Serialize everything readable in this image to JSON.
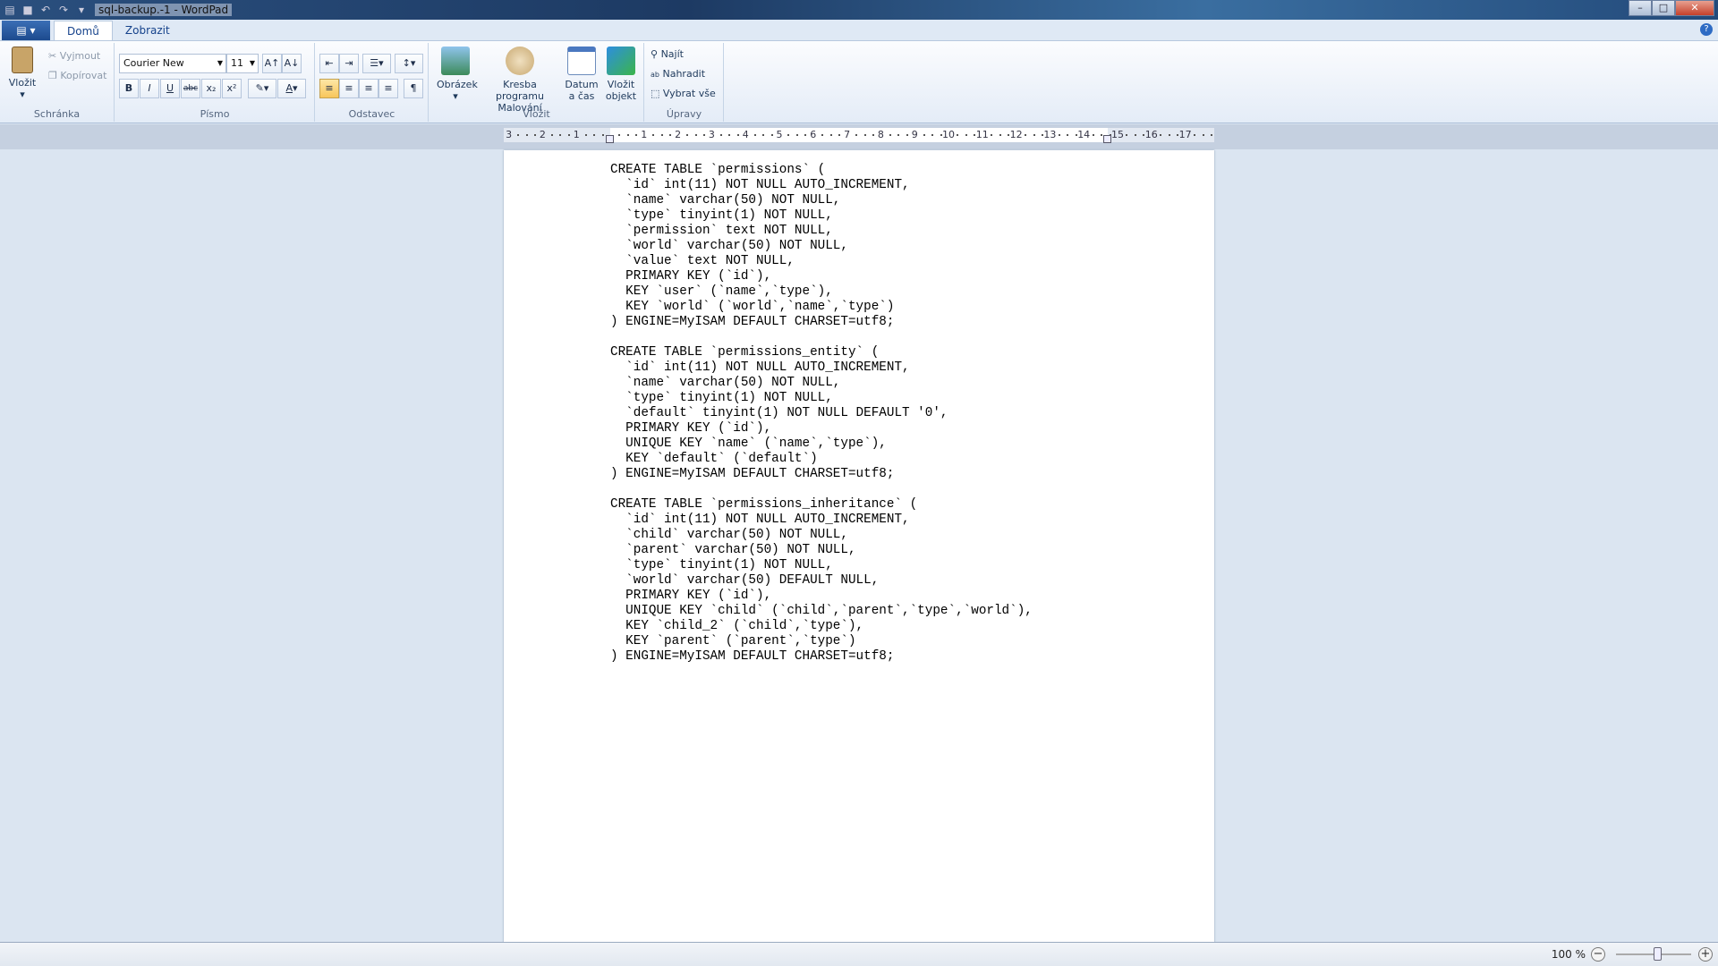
{
  "window": {
    "title": "sql-backup.-1 - WordPad"
  },
  "tabs": [
    {
      "label": "Domů",
      "active": true
    },
    {
      "label": "Zobrazit",
      "active": false
    }
  ],
  "ribbon": {
    "clipboard": {
      "label": "Schránka",
      "paste": "Vložit",
      "cut": "Vyjmout",
      "copy": "Kopírovat"
    },
    "font": {
      "label": "Písmo",
      "family": "Courier New",
      "size": "11"
    },
    "paragraph": {
      "label": "Odstavec"
    },
    "insert": {
      "label": "Vložit",
      "picture": "Obrázek",
      "paint1": "Kresba programu",
      "paint2": "Malování",
      "date1": "Datum",
      "date2": "a čas",
      "object1": "Vložit",
      "object2": "objekt"
    },
    "editing": {
      "label": "Úpravy",
      "find": "Najít",
      "replace": "Nahradit",
      "select_all": "Vybrat vše"
    }
  },
  "ruler": {
    "labels": [
      "3",
      "2",
      "1",
      "",
      "1",
      "2",
      "3",
      "4",
      "5",
      "6",
      "7",
      "8",
      "9",
      "10",
      "11",
      "12",
      "13",
      "14",
      "15",
      "16",
      "17"
    ]
  },
  "document": {
    "lines": [
      "CREATE TABLE `permissions` (",
      "  `id` int(11) NOT NULL AUTO_INCREMENT,",
      "  `name` varchar(50) NOT NULL,",
      "  `type` tinyint(1) NOT NULL,",
      "  `permission` text NOT NULL,",
      "  `world` varchar(50) NOT NULL,",
      "  `value` text NOT NULL,",
      "  PRIMARY KEY (`id`),",
      "  KEY `user` (`name`,`type`),",
      "  KEY `world` (`world`,`name`,`type`)",
      ") ENGINE=MyISAM DEFAULT CHARSET=utf8;",
      "",
      "CREATE TABLE `permissions_entity` (",
      "  `id` int(11) NOT NULL AUTO_INCREMENT,",
      "  `name` varchar(50) NOT NULL,",
      "  `type` tinyint(1) NOT NULL,",
      "  `default` tinyint(1) NOT NULL DEFAULT '0',",
      "  PRIMARY KEY (`id`),",
      "  UNIQUE KEY `name` (`name`,`type`),",
      "  KEY `default` (`default`)",
      ") ENGINE=MyISAM DEFAULT CHARSET=utf8;",
      "",
      "CREATE TABLE `permissions_inheritance` (",
      "  `id` int(11) NOT NULL AUTO_INCREMENT,",
      "  `child` varchar(50) NOT NULL,",
      "  `parent` varchar(50) NOT NULL,",
      "  `type` tinyint(1) NOT NULL,",
      "  `world` varchar(50) DEFAULT NULL,",
      "  PRIMARY KEY (`id`),",
      "  UNIQUE KEY `child` (`child`,`parent`,`type`,`world`),",
      "  KEY `child_2` (`child`,`type`),",
      "  KEY `parent` (`parent`,`type`)",
      ") ENGINE=MyISAM DEFAULT CHARSET=utf8;"
    ]
  },
  "status": {
    "zoom": "100 %",
    "zoom_percent": 100
  }
}
